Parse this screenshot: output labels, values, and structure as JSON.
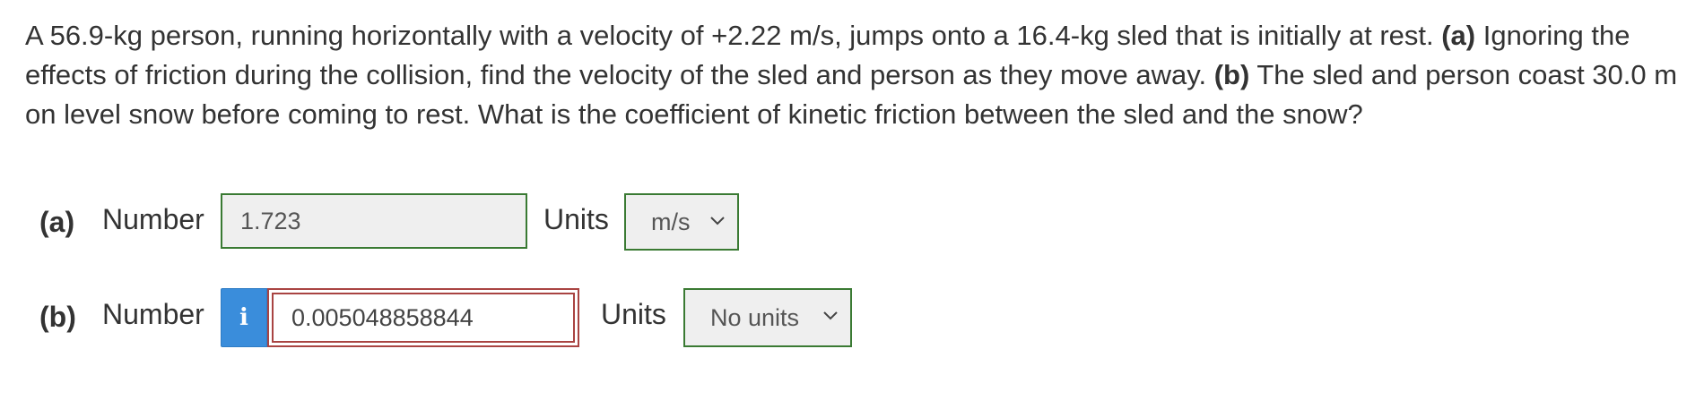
{
  "question": {
    "text_1": "A 56.9-kg person, running horizontally with a velocity of +2.22 m/s, jumps onto a 16.4-kg sled that is initially at rest. ",
    "part_a_marker": "(a)",
    "text_2": " Ignoring the effects of friction during the collision, find the velocity of the sled and person as they move away. ",
    "part_b_marker": "(b)",
    "text_3": " The sled and person coast 30.0 m on level snow before coming to rest. What is the coefficient of kinetic friction between the sled and the snow?"
  },
  "part_a": {
    "label": "(a)",
    "number_label": "Number",
    "value": "1.723",
    "units_label": "Units",
    "units_value": "m/s"
  },
  "part_b": {
    "label": "(b)",
    "number_label": "Number",
    "info_icon_glyph": "i",
    "value": "0.005048858844",
    "units_label": "Units",
    "units_value": "No units"
  },
  "colors": {
    "correct_border": "#3a7a33",
    "error_border": "#a94442",
    "info_button": "#3a8ddb"
  }
}
